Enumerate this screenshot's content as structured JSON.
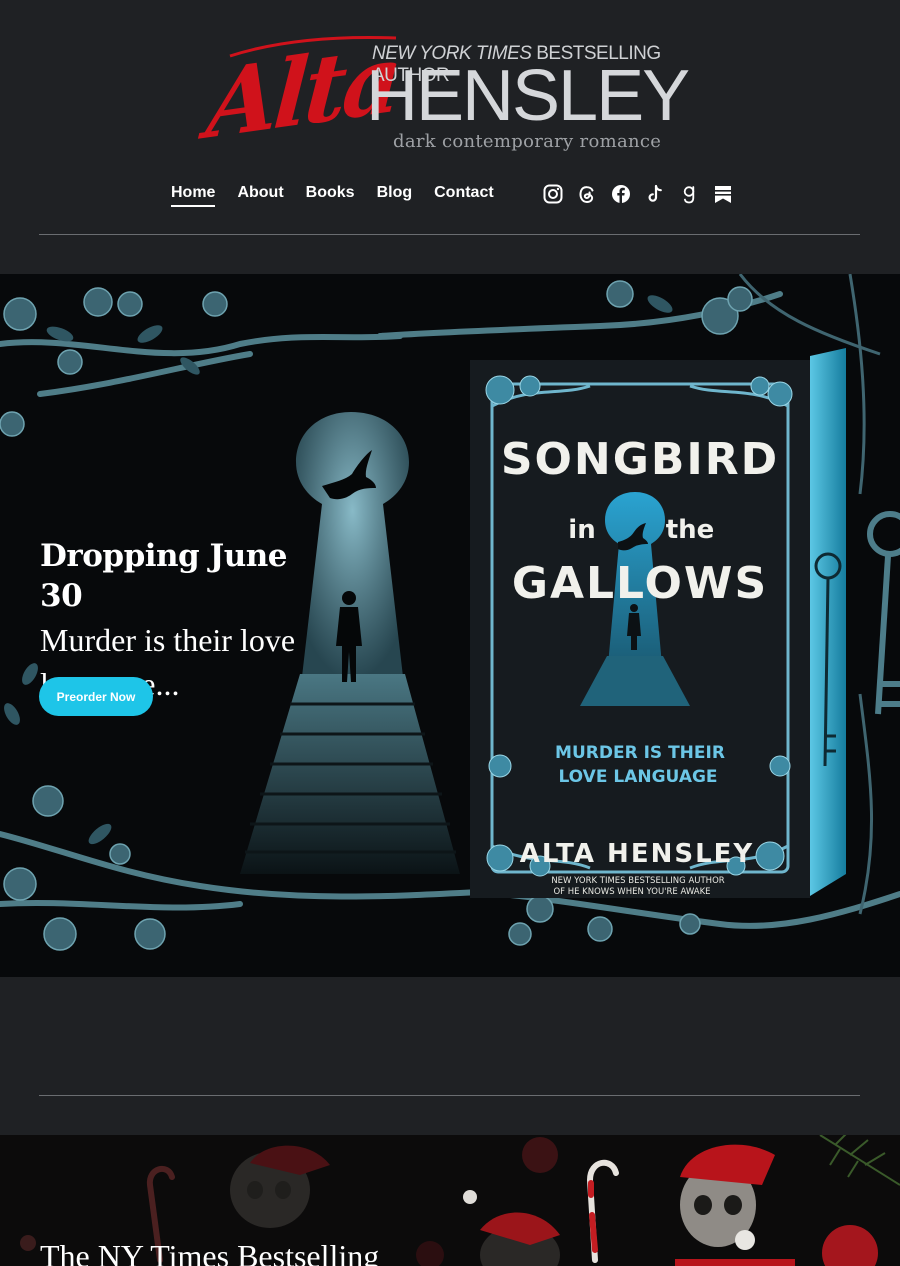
{
  "logo": {
    "script_name": "Alta",
    "kicker_italic": "NEW YORK TIMES",
    "kicker_rest": "BESTSELLING AUTHOR",
    "surname": "HENSLEY",
    "tagline": "dark  contemporary  romance"
  },
  "nav": {
    "items": [
      {
        "label": "Home",
        "active": true
      },
      {
        "label": "About",
        "active": false
      },
      {
        "label": "Books",
        "active": false
      },
      {
        "label": "Blog",
        "active": false
      },
      {
        "label": "Contact",
        "active": false
      }
    ]
  },
  "social": [
    "instagram-icon",
    "threads-icon",
    "facebook-icon",
    "tiktok-icon",
    "goodreads-icon",
    "bookbub-icon"
  ],
  "hero": {
    "date": "Dropping June 30",
    "tagline": "Murder is their love language...",
    "cta": "Preorder Now",
    "accent": "#1ec5e8",
    "book": {
      "title_line1": "SONGBIRD",
      "title_in": "in",
      "title_the": "the",
      "title_line3": "GALLOWS",
      "sub1": "MURDER IS THEIR",
      "sub2": "LOVE LANGUAGE",
      "author": "ALTA HENSLEY",
      "credit1": "NEW YORK TIMES BESTSELLING AUTHOR",
      "credit2": "OF HE KNOWS WHEN YOU'RE AWAKE"
    }
  },
  "section2": {
    "title": "The NY Times Bestselling"
  }
}
